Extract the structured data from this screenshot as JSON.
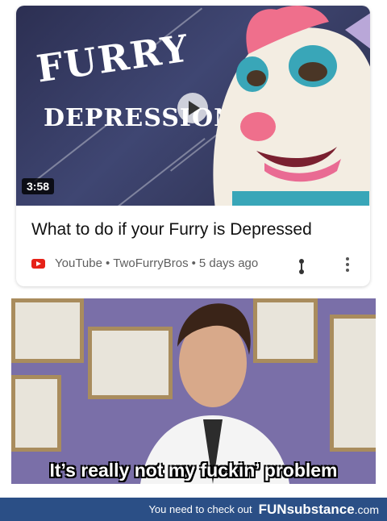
{
  "video": {
    "thumbnail_title_line1": "FURRY",
    "thumbnail_title_line2": "DEPRESSION",
    "duration": "3:58",
    "title": "What to do if your Furry is Depressed",
    "source": "YouTube",
    "channel": "TwoFurryBros",
    "age": "5 days ago",
    "separator": "•"
  },
  "meme": {
    "caption": "It’s really not my fuckin’ problem"
  },
  "footer": {
    "lead_text": "You need to check out",
    "brand_main": "FUNsubstance",
    "brand_domain": ".com"
  },
  "colors": {
    "youtube_red": "#e62117",
    "footer_blue": "#2b4f86"
  }
}
